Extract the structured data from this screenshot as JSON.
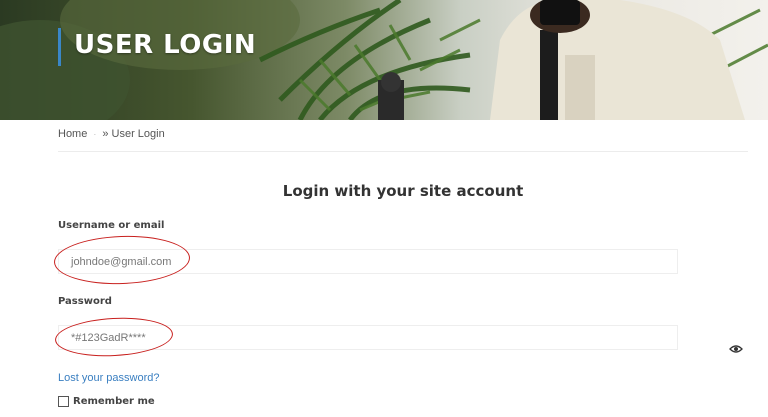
{
  "hero": {
    "title": "USER LOGIN"
  },
  "breadcrumb": {
    "home": "Home",
    "separator": "·",
    "current": "» User Login"
  },
  "login": {
    "heading": "Login with your site account",
    "username_label": "Username or email",
    "username_value": "johndoe@gmail.com",
    "password_label": "Password",
    "password_value": "*#123GadR****",
    "lost_password": "Lost your password?",
    "remember_me": "Remember me"
  },
  "colors": {
    "accent": "#3a87c8",
    "link": "#3a7fc1",
    "annotation": "#c8201e"
  },
  "icons": {
    "password_toggle": "eye-icon"
  }
}
